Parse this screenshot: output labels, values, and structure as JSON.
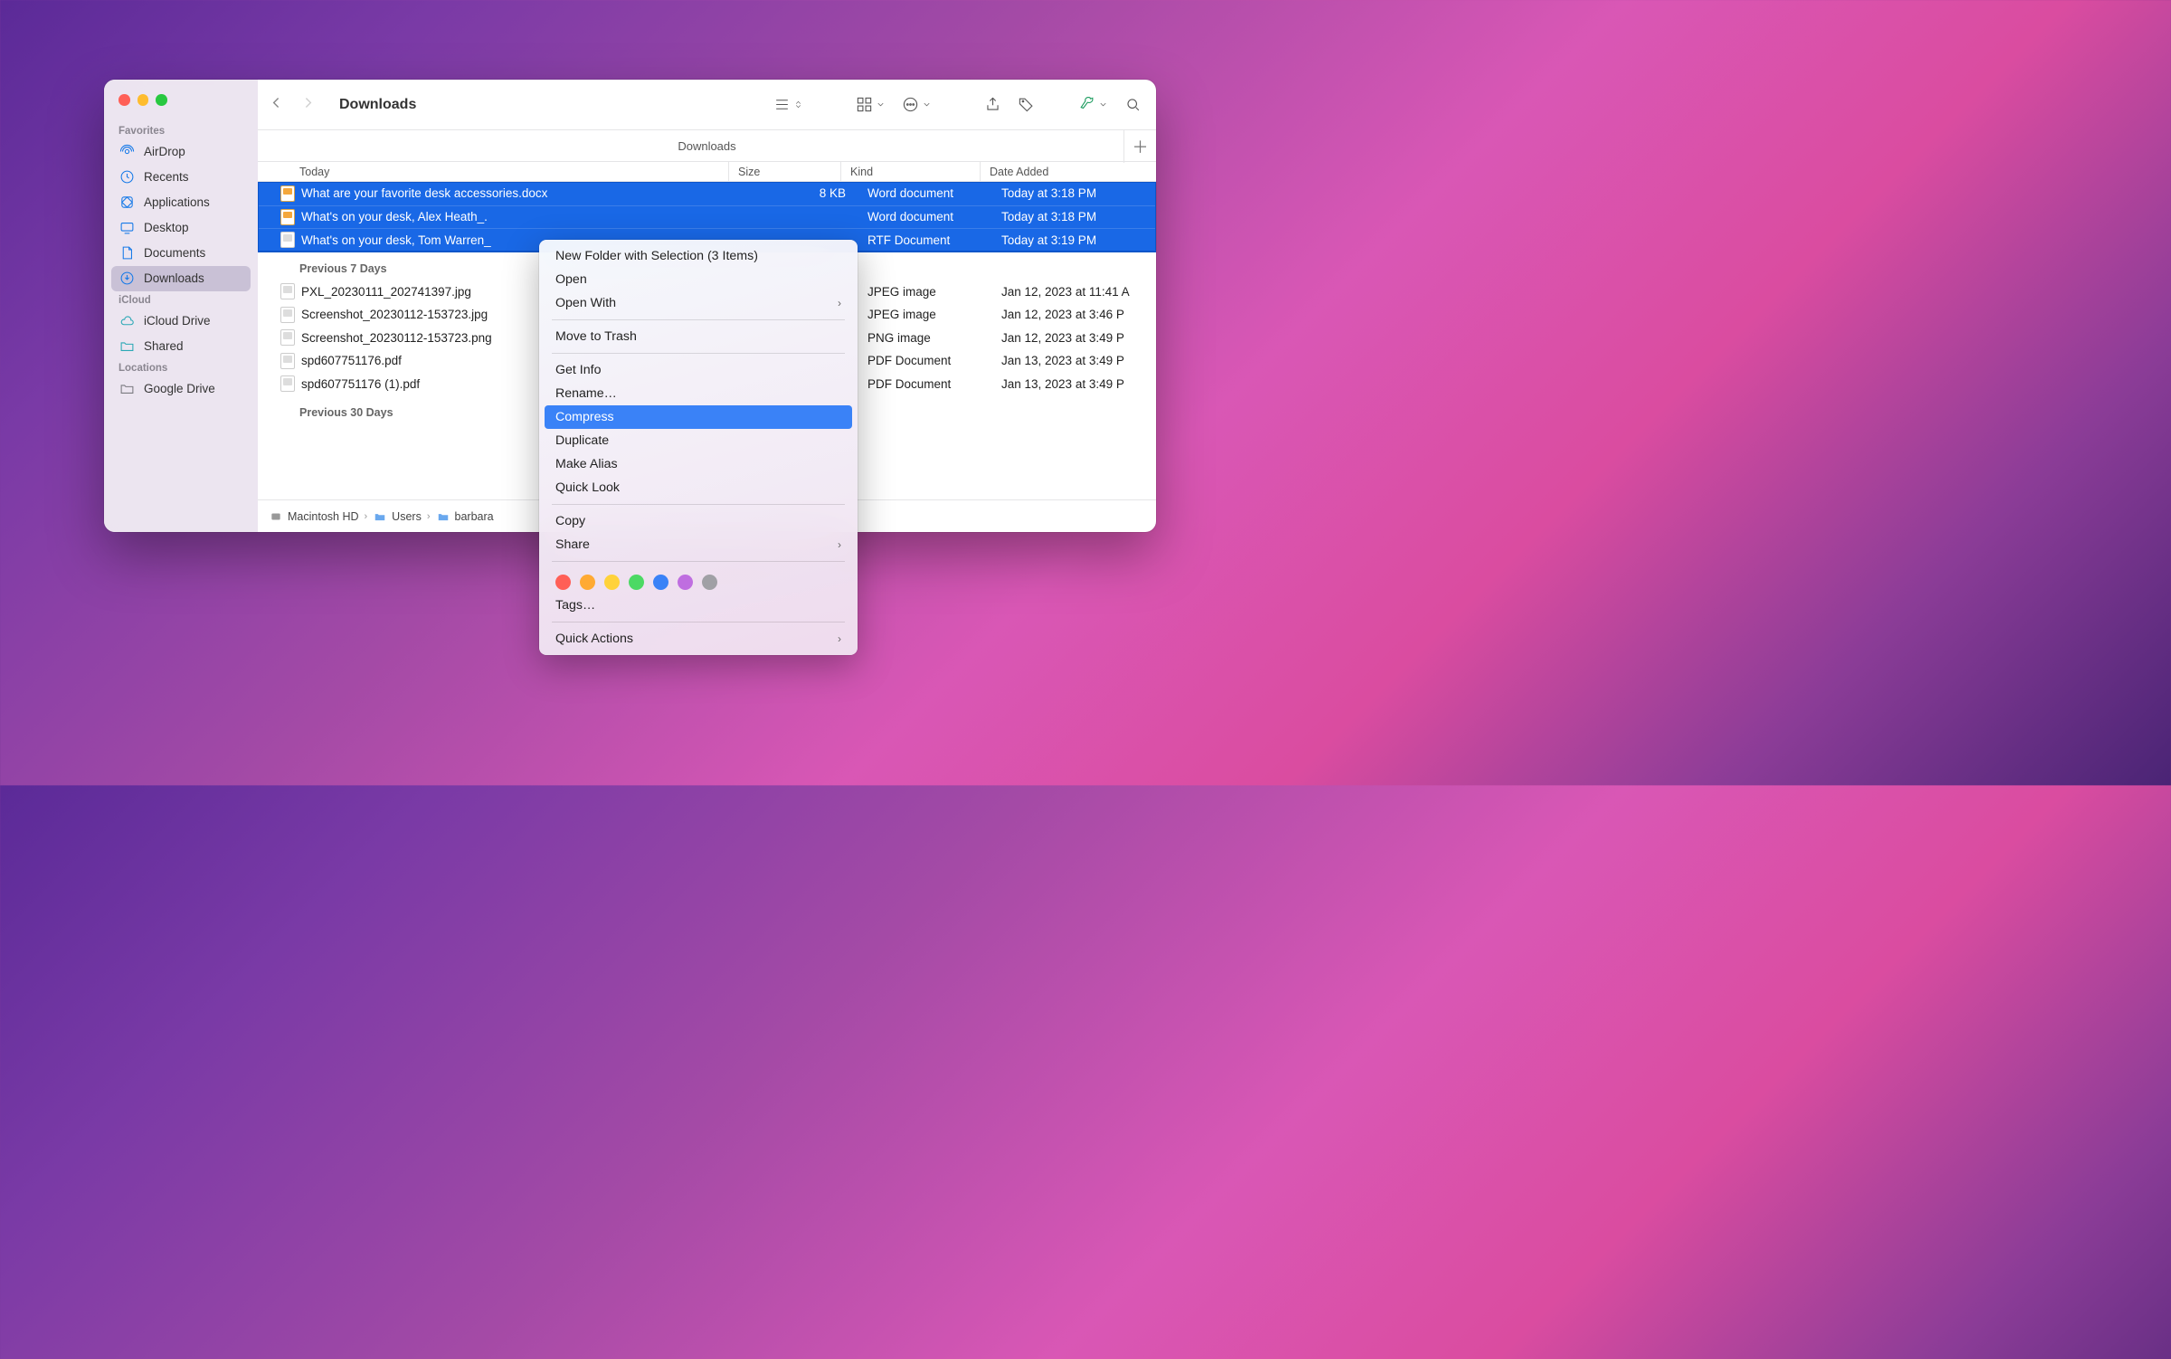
{
  "window": {
    "title": "Downloads",
    "tab": "Downloads"
  },
  "sidebar": {
    "sections": [
      {
        "title": "Favorites",
        "items": [
          "AirDrop",
          "Recents",
          "Applications",
          "Desktop",
          "Documents",
          "Downloads"
        ]
      },
      {
        "title": "iCloud",
        "items": [
          "iCloud Drive",
          "Shared"
        ]
      },
      {
        "title": "Locations",
        "items": [
          "Google Drive"
        ]
      }
    ]
  },
  "columns": {
    "name": "Today",
    "size": "Size",
    "kind": "Kind",
    "date": "Date Added"
  },
  "groups": [
    {
      "header": "",
      "rows": [
        {
          "sel": true,
          "icon": "word",
          "name": "What are your favorite desk accessories.docx",
          "size": "8 KB",
          "kind": "Word document",
          "date": "Today at 3:18 PM"
        },
        {
          "sel": true,
          "icon": "word",
          "name": "What's on your desk, Alex Heath_.",
          "size": "",
          "kind": "Word document",
          "date": "Today at 3:18 PM"
        },
        {
          "sel": true,
          "icon": "rtf",
          "name": "What's on your desk, Tom Warren_",
          "size": "",
          "kind": "RTF Document",
          "date": "Today at 3:19 PM"
        }
      ]
    },
    {
      "header": "Previous 7 Days",
      "rows": [
        {
          "icon": "jpg",
          "name": "PXL_20230111_202741397.jpg",
          "size": "",
          "kind": "JPEG image",
          "date": "Jan 12, 2023 at 11:41 A"
        },
        {
          "icon": "jpg",
          "name": "Screenshot_20230112-153723.jpg",
          "size": "",
          "kind": "JPEG image",
          "date": "Jan 12, 2023 at 3:46 P"
        },
        {
          "icon": "png",
          "name": "Screenshot_20230112-153723.png",
          "size": "",
          "kind": "PNG image",
          "date": "Jan 12, 2023 at 3:49 P"
        },
        {
          "icon": "pdf",
          "name": "spd607751176.pdf",
          "size": "",
          "kind": "PDF Document",
          "date": "Jan 13, 2023 at 3:49 P"
        },
        {
          "icon": "pdf",
          "name": "spd607751176 (1).pdf",
          "size": "",
          "kind": "PDF Document",
          "date": "Jan 13, 2023 at 3:49 P"
        }
      ]
    },
    {
      "header": "Previous 30 Days",
      "rows": []
    }
  ],
  "pathbar": [
    "Macintosh HD",
    "Users",
    "barbara"
  ],
  "context_menu": {
    "items": [
      {
        "t": "New Folder with Selection (3 Items)"
      },
      {
        "t": "Open"
      },
      {
        "t": "Open With",
        "sub": true
      },
      {
        "sep": true
      },
      {
        "t": "Move to Trash"
      },
      {
        "sep": true
      },
      {
        "t": "Get Info"
      },
      {
        "t": "Rename…"
      },
      {
        "t": "Compress",
        "hl": true
      },
      {
        "t": "Duplicate"
      },
      {
        "t": "Make Alias"
      },
      {
        "t": "Quick Look"
      },
      {
        "sep": true
      },
      {
        "t": "Copy"
      },
      {
        "t": "Share",
        "sub": true
      },
      {
        "sep": true
      },
      {
        "tags": true
      },
      {
        "t": "Tags…"
      },
      {
        "sep": true
      },
      {
        "t": "Quick Actions",
        "sub": true
      }
    ]
  }
}
